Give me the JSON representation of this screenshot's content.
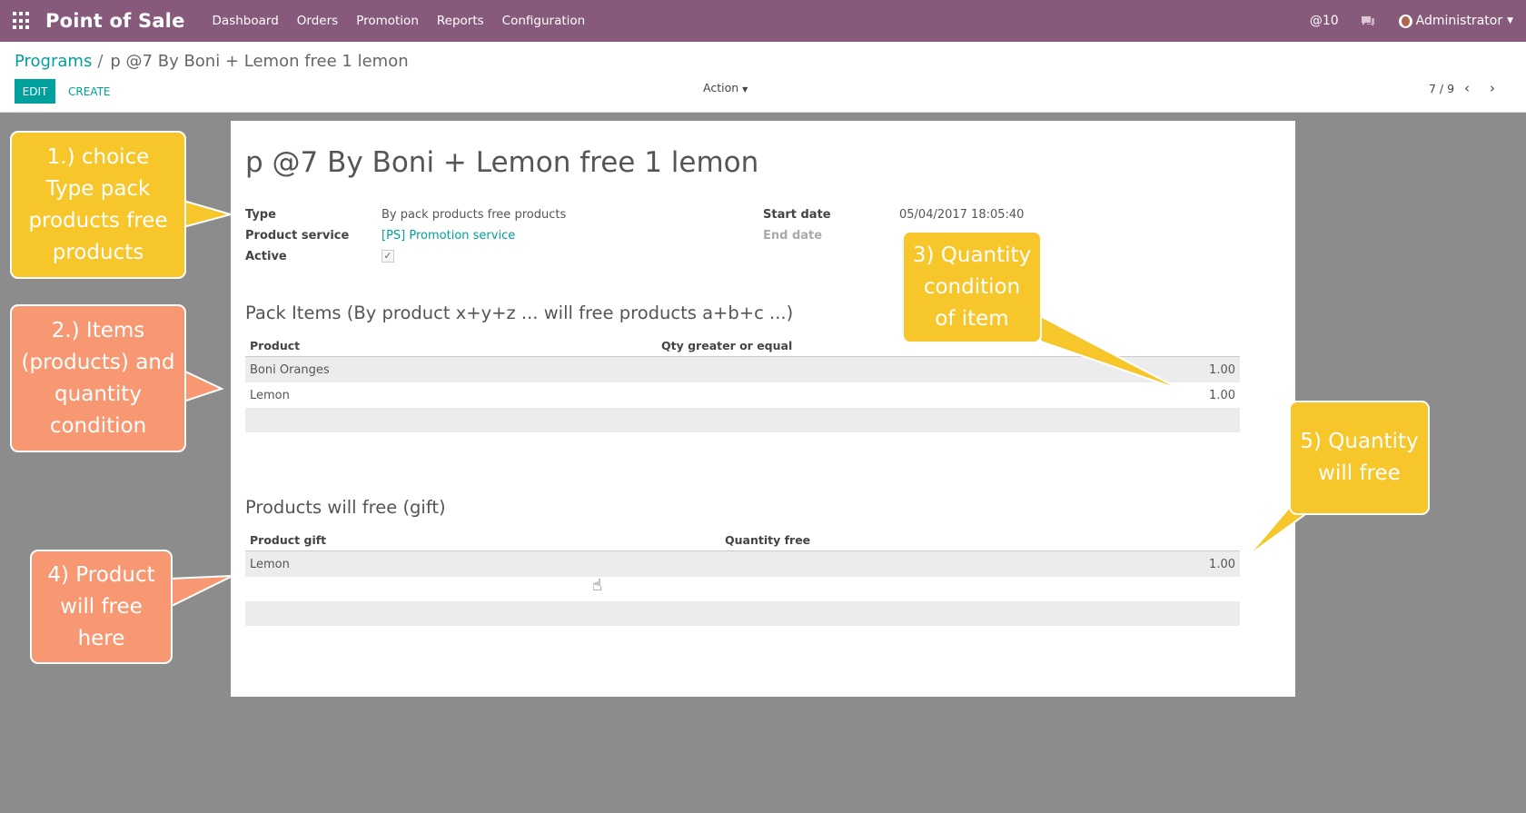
{
  "navbar": {
    "app_title": "Point of Sale",
    "menu": [
      "Dashboard",
      "Orders",
      "Promotion",
      "Reports",
      "Configuration"
    ],
    "mentions": "@10",
    "user": "Administrator",
    "colors": {
      "bar": "#875a7b",
      "accent": "#00a09d"
    }
  },
  "breadcrumb": {
    "parent": "Programs",
    "separator": "/",
    "current": "p @7 By Boni + Lemon free 1 lemon"
  },
  "toolbar": {
    "edit_label": "EDIT",
    "create_label": "CREATE",
    "action_label": "Action",
    "pager": "7 / 9"
  },
  "record": {
    "title": "p @7 By Boni + Lemon free 1 lemon",
    "fields": {
      "type_label": "Type",
      "type_value": "By pack products free products",
      "service_label": "Product service",
      "service_value": "[PS] Promotion service",
      "active_label": "Active",
      "active_checked": true,
      "start_label": "Start date",
      "start_value": "05/04/2017 18:05:40",
      "end_label": "End date"
    },
    "pack_items": {
      "title": "Pack Items (By product x+y+z ... will free products a+b+c ...)",
      "columns": [
        "Product",
        "Qty greater or equal"
      ],
      "rows": [
        {
          "product": "Boni Oranges",
          "qty": "1.00"
        },
        {
          "product": "Lemon",
          "qty": "1.00"
        }
      ]
    },
    "free_products": {
      "title": "Products will free (gift)",
      "columns": [
        "Product gift",
        "Quantity free"
      ],
      "rows": [
        {
          "product": "Lemon",
          "qty": "1.00"
        }
      ]
    }
  },
  "callouts": {
    "c1": {
      "lines": [
        "1.) choice",
        "Type pack",
        "products free",
        "products"
      ],
      "color": "#f6c62a"
    },
    "c2": {
      "lines": [
        "2.) Items",
        "(products) and",
        "quantity",
        "condition"
      ],
      "color": "#f79872"
    },
    "c3": {
      "lines": [
        "3) Quantity",
        "condition",
        "of item"
      ],
      "color": "#f6c62a"
    },
    "c4": {
      "lines": [
        "4) Product",
        "will free",
        "here"
      ],
      "color": "#f79872"
    },
    "c5": {
      "lines": [
        "5) Quantity",
        "will free"
      ],
      "color": "#f6c62a"
    }
  }
}
